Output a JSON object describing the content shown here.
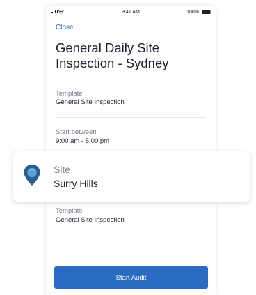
{
  "status_bar": {
    "time": "9:41 AM",
    "battery": "100%"
  },
  "header": {
    "close_label": "Close",
    "title": "General Daily Site Inspection - Sydney"
  },
  "fields": {
    "template_1": {
      "label": "Template",
      "value": "General Site Inspection"
    },
    "start_between": {
      "label": "Start between",
      "value": "9:00 am - 5:00 pm"
    },
    "template_2": {
      "label": "Template",
      "value": "General Site Inspection"
    }
  },
  "site_card": {
    "label": "Site",
    "value": "Surry Hills",
    "icon": "location-pin-icon"
  },
  "actions": {
    "start_label": "Start Audit"
  },
  "colors": {
    "accent": "#2a6cc4",
    "text_primary": "#1e2230",
    "text_secondary": "#7a7f8a",
    "pin_outer": "#2d5b93",
    "pin_inner": "#5aa0dc"
  }
}
